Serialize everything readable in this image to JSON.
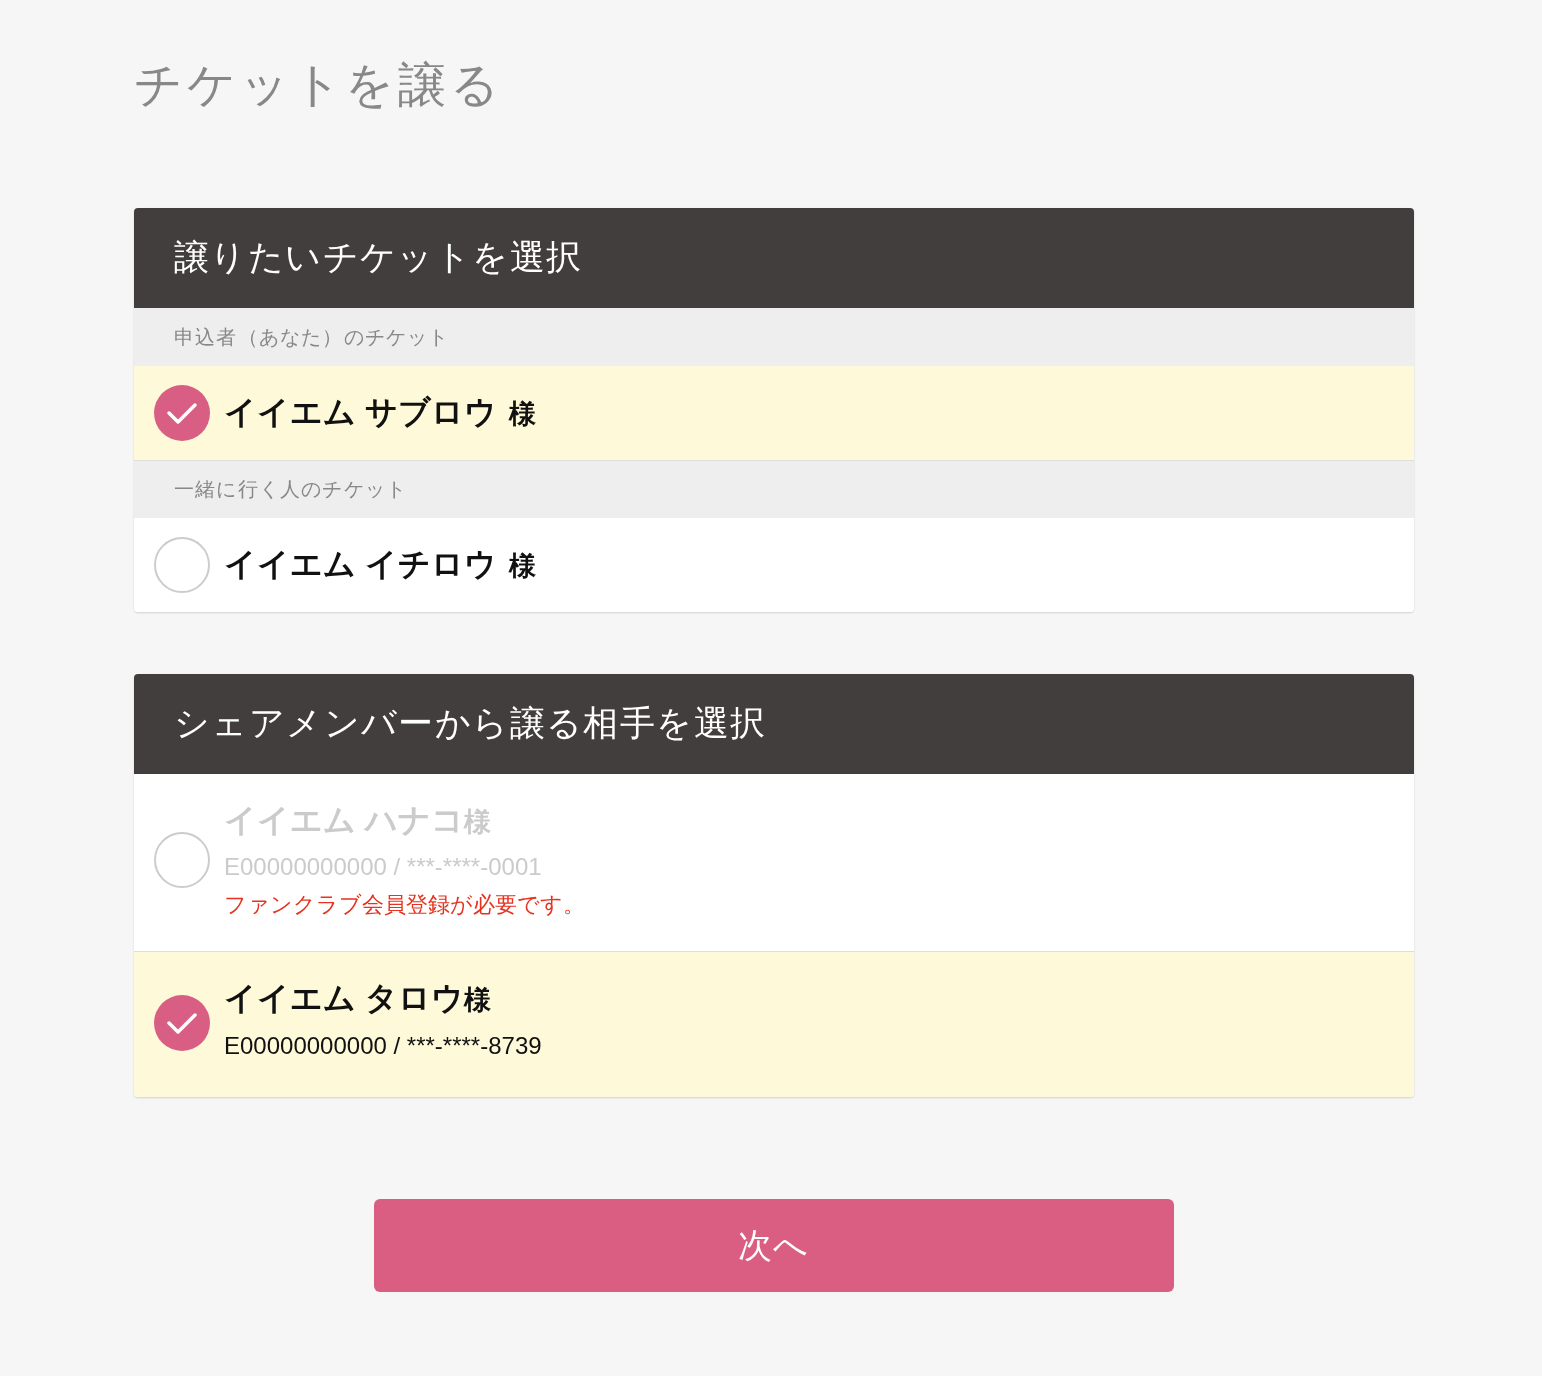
{
  "page": {
    "title": "チケットを譲る"
  },
  "ticket_panel": {
    "heading": "譲りたいチケットを選択",
    "groups": [
      {
        "label": "申込者（あなた）のチケット",
        "items": [
          {
            "name": "イイエム サブロウ",
            "honorific": "様",
            "selected": true
          }
        ]
      },
      {
        "label": "一緒に行く人のチケット",
        "items": [
          {
            "name": "イイエム イチロウ",
            "honorific": "様",
            "selected": false
          }
        ]
      }
    ]
  },
  "member_panel": {
    "heading": "シェアメンバーから譲る相手を選択",
    "members": [
      {
        "name": "イイエム ハナコ",
        "honorific": "様",
        "member_info": "E00000000000 / ***-****-0001",
        "note": "ファンクラブ会員登録が必要です。",
        "disabled": true,
        "selected": false
      },
      {
        "name": "イイエム タロウ",
        "honorific": "様",
        "member_info": "E00000000000 / ***-****-8739",
        "disabled": false,
        "selected": true
      }
    ]
  },
  "next_button": {
    "label": "次へ"
  }
}
